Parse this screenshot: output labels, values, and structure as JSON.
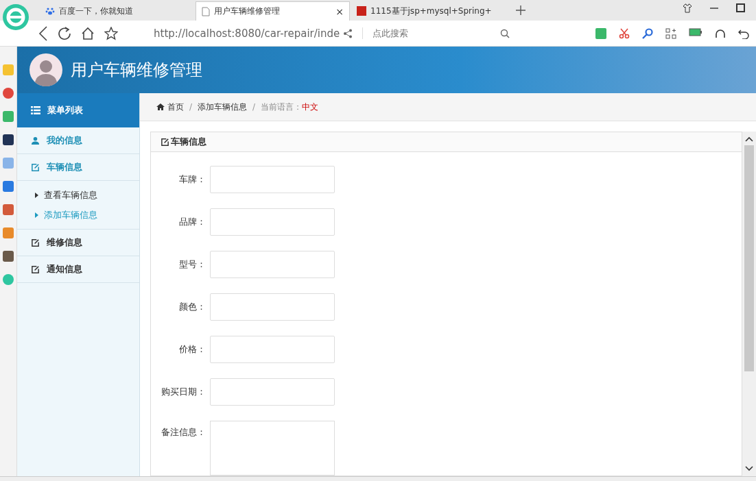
{
  "browser": {
    "tabs": [
      {
        "title": "百度一下，你就知道",
        "selected": false
      },
      {
        "title": "用户车辆维修管理",
        "selected": true,
        "close": "×"
      },
      {
        "title": "1115基于jsp+mysql+Spring+",
        "selected": false
      }
    ],
    "url": "http://localhost:8080/car-repair/inde",
    "search": {
      "placeholder": "点此搜索"
    }
  },
  "app": {
    "title": "用户车辆维修管理"
  },
  "sidebar": {
    "header": "菜单列表",
    "items": [
      {
        "label": "我的信息",
        "kind": "profile",
        "highlighted": true
      },
      {
        "label": "车辆信息",
        "kind": "edit",
        "highlighted": true,
        "children": [
          {
            "label": "查看车辆信息",
            "selected": false
          },
          {
            "label": "添加车辆信息",
            "selected": true
          }
        ]
      },
      {
        "label": "维修信息",
        "kind": "edit",
        "highlighted": false
      },
      {
        "label": "通知信息",
        "kind": "edit",
        "highlighted": false
      }
    ]
  },
  "breadcrumb": {
    "home": "首页",
    "separator_1": "/",
    "current": "添加车辆信息",
    "separator_2": "/",
    "language_label": "当前语言：",
    "language": "中文"
  },
  "panel": {
    "title": "车辆信息",
    "fields": [
      {
        "label": "车牌：",
        "kind": "input"
      },
      {
        "label": "品牌：",
        "kind": "input"
      },
      {
        "label": "型号：",
        "kind": "input"
      },
      {
        "label": "颜色：",
        "kind": "input"
      },
      {
        "label": "价格：",
        "kind": "input"
      },
      {
        "label": "购买日期：",
        "kind": "input"
      },
      {
        "label": "备注信息：",
        "kind": "textarea"
      }
    ]
  }
}
